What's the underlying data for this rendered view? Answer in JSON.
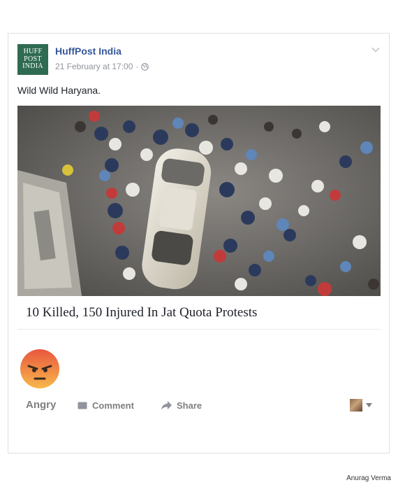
{
  "post": {
    "page_name": "HuffPost India",
    "avatar_lines": [
      "HUFF",
      "POST",
      "INDIA"
    ],
    "timestamp": "21 February at 17:00",
    "privacy_separator": "·",
    "privacy_icon": "globe-icon",
    "menu_icon": "chevron-down-icon",
    "text": "Wild Wild Haryana."
  },
  "link_preview": {
    "title": "10 Killed, 150 Injured In Jat Quota Protests"
  },
  "reactions": {
    "selected": "Angry",
    "emoji_icon": "angry-emoji-icon"
  },
  "actions": {
    "comment_label": "Comment",
    "share_label": "Share",
    "audience_icon": "user-avatar-thumbnail",
    "audience_dropdown_icon": "caret-down-icon"
  },
  "credit": "Anurag Verma",
  "colors": {
    "page_name": "#365899",
    "meta": "#90949c",
    "avatar_bg": "#2f6b52",
    "action_text": "#7f7f7f",
    "angry_top": "#e9573f",
    "angry_bottom": "#f7b84b"
  }
}
